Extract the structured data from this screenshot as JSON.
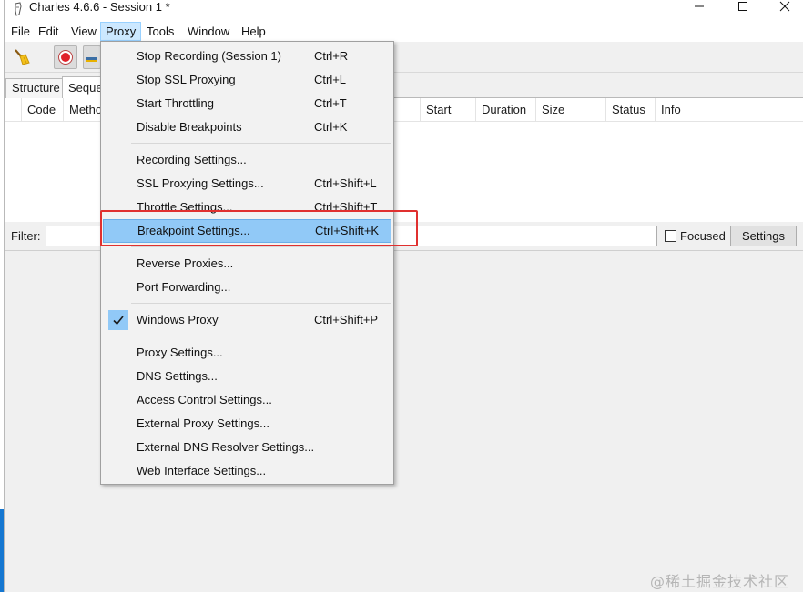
{
  "window": {
    "title": "Charles 4.6.6 - Session 1 *"
  },
  "menubar": {
    "items": [
      "File",
      "Edit",
      "View",
      "Proxy",
      "Tools",
      "Window",
      "Help"
    ],
    "active": "Proxy"
  },
  "toolbar": {
    "icons": [
      "broom-icon",
      "record-icon",
      "throttle-icon"
    ]
  },
  "tabs": {
    "structure": "Structure",
    "sequence": "Seque"
  },
  "table": {
    "columns": [
      "Code",
      "Metho",
      "Start",
      "Duration",
      "Size",
      "Status",
      "Info"
    ]
  },
  "filter": {
    "label": "Filter:",
    "value": "",
    "focused_label": "Focused",
    "focused_checked": false,
    "settings_label": "Settings"
  },
  "proxy_menu": {
    "items": [
      {
        "label": "Stop Recording (Session 1)",
        "shortcut": "Ctrl+R"
      },
      {
        "label": "Stop SSL Proxying",
        "shortcut": "Ctrl+L"
      },
      {
        "label": "Start Throttling",
        "shortcut": "Ctrl+T"
      },
      {
        "label": "Disable Breakpoints",
        "shortcut": "Ctrl+K"
      },
      {
        "label": "Recording Settings...",
        "shortcut": ""
      },
      {
        "label": "SSL Proxying Settings...",
        "shortcut": "Ctrl+Shift+L"
      },
      {
        "label": "Throttle Settings...",
        "shortcut": "Ctrl+Shift+T"
      },
      {
        "label": "Breakpoint Settings...",
        "shortcut": "Ctrl+Shift+K"
      },
      {
        "label": "Reverse Proxies...",
        "shortcut": ""
      },
      {
        "label": "Port Forwarding...",
        "shortcut": ""
      },
      {
        "label": "Windows Proxy",
        "shortcut": "Ctrl+Shift+P",
        "checked": true
      },
      {
        "label": "Proxy Settings...",
        "shortcut": ""
      },
      {
        "label": "DNS Settings...",
        "shortcut": ""
      },
      {
        "label": "Access Control Settings...",
        "shortcut": ""
      },
      {
        "label": "External Proxy Settings...",
        "shortcut": ""
      },
      {
        "label": "External DNS Resolver Settings...",
        "shortcut": ""
      },
      {
        "label": "Web Interface Settings...",
        "shortcut": ""
      }
    ],
    "highlighted": "Breakpoint Settings..."
  },
  "annotation": {
    "color": "#e0302f"
  },
  "watermark": "@稀土掘金技术社区",
  "colors": {
    "menu_highlight": "#91c9f7",
    "menubar_active": "#cce8ff",
    "record_red": "#e0202a"
  }
}
